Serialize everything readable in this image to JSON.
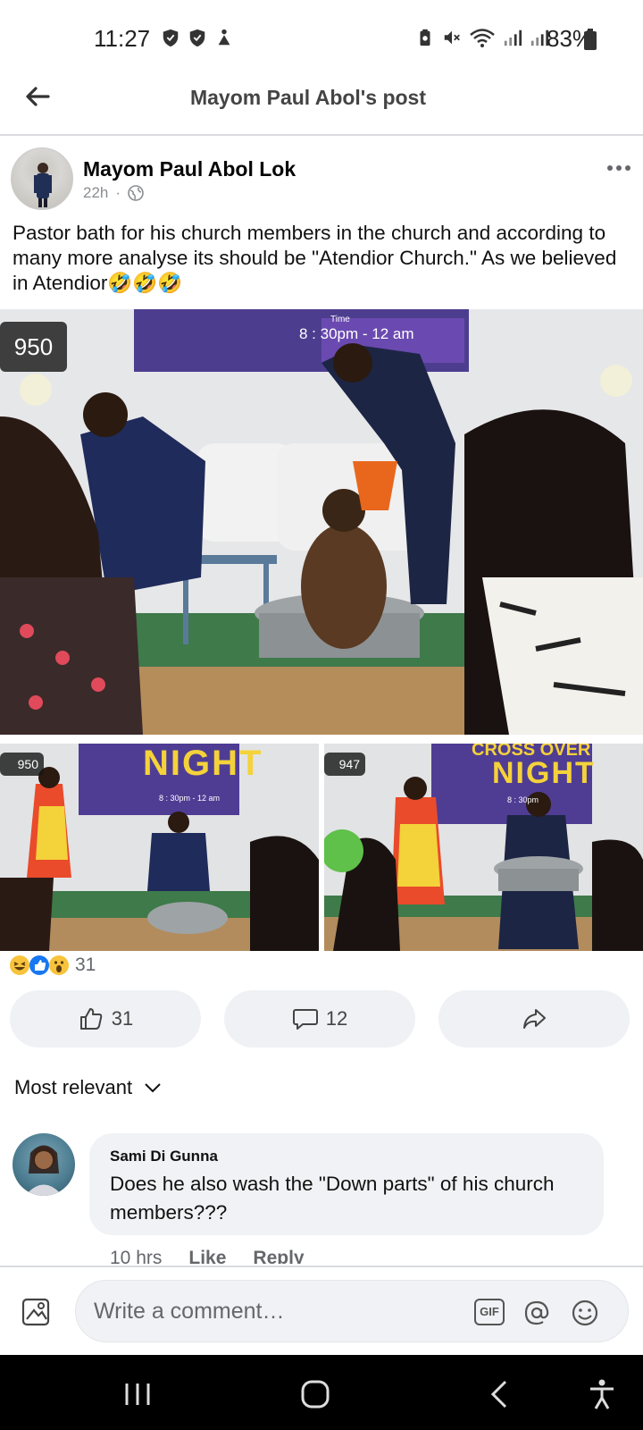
{
  "status_bar": {
    "time": "11:27",
    "battery": "83%"
  },
  "header": {
    "title": "Mayom Paul Abol's post"
  },
  "post": {
    "author": "Mayom Paul Abol Lok",
    "time": "22h",
    "separator": "·",
    "text": "Pastor bath for his church members in the church and according to many more analyse its should be \"Atendior Church.\" As we believed in Atendior🤣🤣🤣",
    "photos": [
      {
        "view_count": "950",
        "banner_time_label": "Time",
        "banner_time": "8 : 30pm - 12 am"
      },
      {
        "view_count": "950",
        "banner_title": "NIGHT",
        "banner_time": "8 : 30pm - 12 am"
      },
      {
        "view_count": "947",
        "banner_title_top": "CROSS OVER",
        "banner_title": "NIGHT",
        "banner_time": "8 : 30pm"
      }
    ],
    "reactions": {
      "icons": [
        "haha",
        "like",
        "wow"
      ],
      "count": "31"
    },
    "actions": {
      "like_count": "31",
      "comment_count": "12"
    }
  },
  "comments": {
    "sort_label": "Most relevant",
    "items": [
      {
        "name": "Sami Di Gunna",
        "text": "Does he also wash the \"Down parts\" of his church members???",
        "time": "10 hrs",
        "like_label": "Like",
        "reply_label": "Reply"
      }
    ]
  },
  "composer": {
    "placeholder": "Write a comment…",
    "gif_label": "GIF"
  },
  "colors": {
    "pill_bg": "#eff1f4",
    "bubble_bg": "#f0f2f5",
    "secondary_text": "#65676b",
    "like_blue": "#1877f2"
  }
}
